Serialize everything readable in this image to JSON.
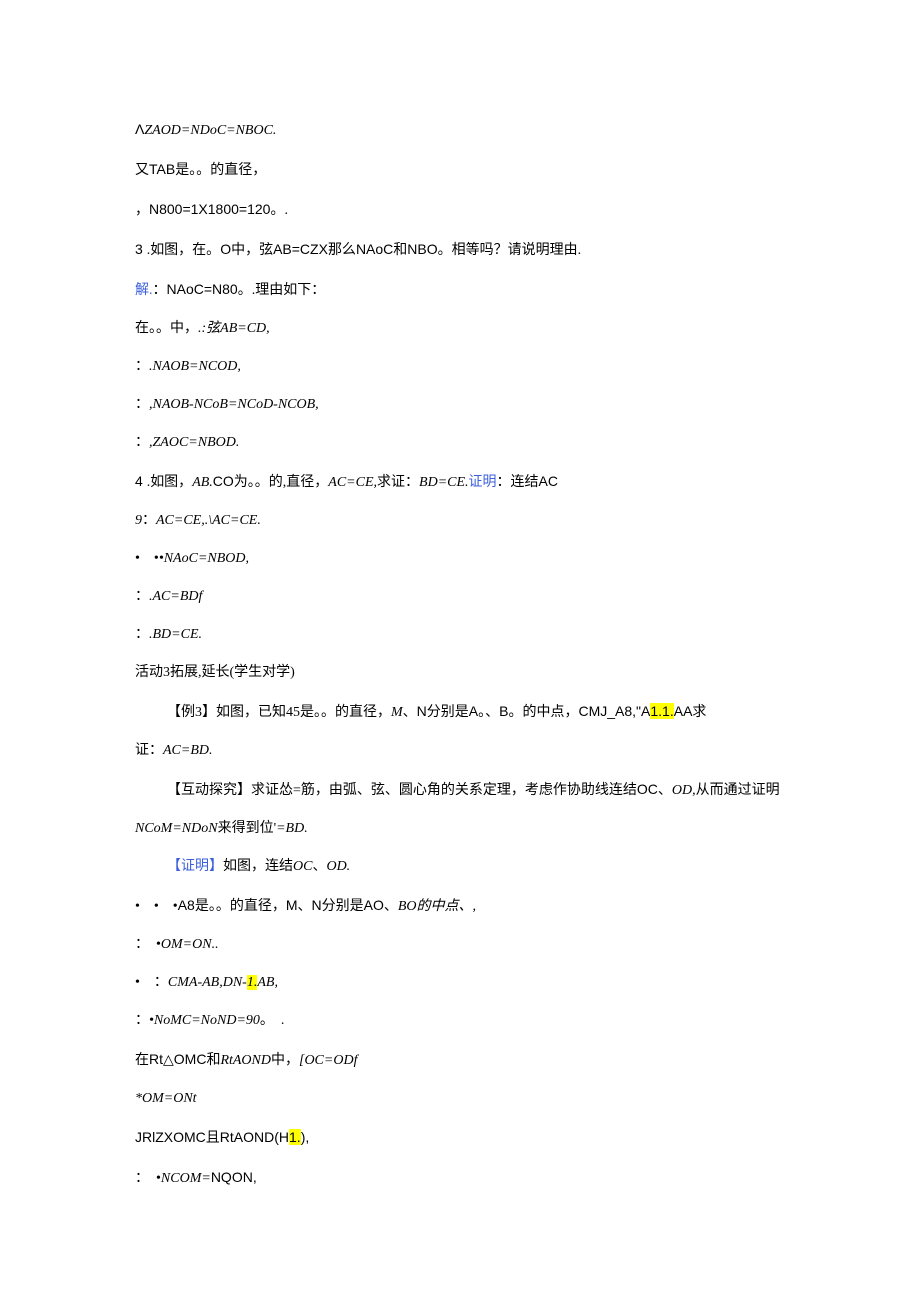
{
  "lines": [
    {
      "cls": "line",
      "segs": [
        {
          "cls": "sans",
          "txt": "Λ"
        },
        {
          "cls": "italic",
          "txt": "ZAOD=NDoC=NBOC."
        }
      ]
    },
    {
      "cls": "line",
      "segs": [
        {
          "cls": "",
          "txt": "又"
        },
        {
          "cls": "sans",
          "txt": "TAB"
        },
        {
          "cls": "",
          "txt": "是。。的直径，"
        }
      ]
    },
    {
      "cls": "line",
      "segs": [
        {
          "cls": "",
          "txt": "，"
        },
        {
          "cls": "sans",
          "txt": "N800=1X1800=120"
        },
        {
          "cls": "",
          "txt": "。."
        }
      ]
    },
    {
      "cls": "line",
      "segs": [
        {
          "cls": "sans",
          "txt": "3 "
        },
        {
          "cls": "",
          "txt": ".如图，在。"
        },
        {
          "cls": "sans",
          "txt": "O"
        },
        {
          "cls": "",
          "txt": "中，弦"
        },
        {
          "cls": "sans",
          "txt": "AB=CZX"
        },
        {
          "cls": "",
          "txt": "那么"
        },
        {
          "cls": "sans",
          "txt": "NAoC"
        },
        {
          "cls": "",
          "txt": "和"
        },
        {
          "cls": "sans",
          "txt": "NBO"
        },
        {
          "cls": "",
          "txt": "。相等吗？请说明理由."
        }
      ]
    },
    {
      "cls": "line",
      "segs": [
        {
          "cls": "blue",
          "txt": "解."
        },
        {
          "cls": "",
          "txt": "："
        },
        {
          "cls": "sans",
          "txt": "NAoC=N80"
        },
        {
          "cls": "",
          "txt": "。.理由如下："
        }
      ]
    },
    {
      "cls": "line",
      "segs": [
        {
          "cls": "",
          "txt": "在。。中，"
        },
        {
          "cls": "italic",
          "txt": ".:弦AB=CD,"
        }
      ]
    },
    {
      "cls": "line",
      "segs": [
        {
          "cls": "",
          "txt": "："
        },
        {
          "cls": "italic",
          "txt": ".NAOB=NCOD,"
        }
      ]
    },
    {
      "cls": "line",
      "segs": [
        {
          "cls": "",
          "txt": "："
        },
        {
          "cls": "italic",
          "txt": ",NAOB-NCoB=NCoD-NCOB,"
        }
      ]
    },
    {
      "cls": "line",
      "segs": [
        {
          "cls": "",
          "txt": "："
        },
        {
          "cls": "italic",
          "txt": ",ZAOC=NBOD."
        }
      ]
    },
    {
      "cls": "line",
      "segs": [
        {
          "cls": "sans",
          "txt": "4 "
        },
        {
          "cls": "",
          "txt": ".如图，"
        },
        {
          "cls": "italic",
          "txt": "AB."
        },
        {
          "cls": "sans",
          "txt": "CO"
        },
        {
          "cls": "",
          "txt": "为。。的,直径，"
        },
        {
          "cls": "italic",
          "txt": "AC=CE,"
        },
        {
          "cls": "",
          "txt": "求证："
        },
        {
          "cls": "italic",
          "txt": "BD=CE."
        },
        {
          "cls": "blue",
          "txt": "证明"
        },
        {
          "cls": "",
          "txt": "：连结"
        },
        {
          "cls": "sans",
          "txt": "AC"
        }
      ]
    },
    {
      "cls": "line",
      "segs": [
        {
          "cls": "italic",
          "txt": " 9"
        },
        {
          "cls": "",
          "txt": "："
        },
        {
          "cls": "italic",
          "txt": "AC=CE,.\\AC=CE."
        }
      ]
    },
    {
      "cls": "line",
      "segs": [
        {
          "cls": "",
          "txt": "•　•"
        },
        {
          "cls": "italic",
          "txt": "•NAoC=NBOD,"
        }
      ]
    },
    {
      "cls": "line",
      "segs": [
        {
          "cls": "",
          "txt": "："
        },
        {
          "cls": "italic",
          "txt": ".AC=BDf"
        }
      ]
    },
    {
      "cls": "line",
      "segs": [
        {
          "cls": "",
          "txt": "："
        },
        {
          "cls": "italic",
          "txt": ".BD=CE."
        }
      ]
    },
    {
      "cls": "line",
      "segs": [
        {
          "cls": "",
          "txt": "活动3拓展,延长(学生对学)"
        }
      ]
    },
    {
      "cls": "line indent1",
      "segs": [
        {
          "cls": "",
          "txt": "【例3】如图，已知45是。。的直径，"
        },
        {
          "cls": "italic",
          "txt": "M"
        },
        {
          "cls": "",
          "txt": "、"
        },
        {
          "cls": "sans",
          "txt": "N"
        },
        {
          "cls": "",
          "txt": "分别是"
        },
        {
          "cls": "sans",
          "txt": "A"
        },
        {
          "cls": "",
          "txt": "。、"
        },
        {
          "cls": "sans",
          "txt": "B"
        },
        {
          "cls": "",
          "txt": "。的中点，"
        },
        {
          "cls": "sans",
          "txt": "CMJ_A8,\"A"
        },
        {
          "cls": "hl sans",
          "txt": "1.1."
        },
        {
          "cls": "sans",
          "txt": "AA"
        },
        {
          "cls": "",
          "txt": "求"
        }
      ]
    },
    {
      "cls": "line indent-neg",
      "segs": [
        {
          "cls": "",
          "txt": "证："
        },
        {
          "cls": "italic",
          "txt": "AC=BD."
        }
      ]
    },
    {
      "cls": "line indent1",
      "segs": [
        {
          "cls": "",
          "txt": "【互动探究】求证怂=筋，由弧、弦、圆心角的关系定理，考虑作协助线连结"
        },
        {
          "cls": "sans",
          "txt": "OC"
        },
        {
          "cls": "",
          "txt": "、"
        },
        {
          "cls": "italic",
          "txt": "OD,"
        },
        {
          "cls": "",
          "txt": "从而通过证明"
        }
      ]
    },
    {
      "cls": "line indent-neg",
      "segs": [
        {
          "cls": "italic",
          "txt": "NCoM=NDoN"
        },
        {
          "cls": "",
          "txt": "来得到位'"
        },
        {
          "cls": "italic",
          "txt": "=BD."
        }
      ]
    },
    {
      "cls": "line indent1",
      "segs": [
        {
          "cls": "blue",
          "txt": "【证明】"
        },
        {
          "cls": "",
          "txt": "如图，连结"
        },
        {
          "cls": "italic",
          "txt": "OC"
        },
        {
          "cls": "",
          "txt": "、"
        },
        {
          "cls": "italic",
          "txt": "OD."
        }
      ]
    },
    {
      "cls": "line",
      "segs": [
        {
          "cls": "",
          "txt": "•　•　•"
        },
        {
          "cls": "sans",
          "txt": "A8"
        },
        {
          "cls": "",
          "txt": "是。。的直径，"
        },
        {
          "cls": "sans",
          "txt": "M"
        },
        {
          "cls": "",
          "txt": "、"
        },
        {
          "cls": "sans",
          "txt": "N"
        },
        {
          "cls": "",
          "txt": "分别是"
        },
        {
          "cls": "sans",
          "txt": "AO"
        },
        {
          "cls": "",
          "txt": "、"
        },
        {
          "cls": "italic",
          "txt": "BO的中点、,"
        }
      ]
    },
    {
      "cls": "line",
      "segs": [
        {
          "cls": "",
          "txt": "：　•"
        },
        {
          "cls": "italic",
          "txt": "OM=ON.."
        }
      ]
    },
    {
      "cls": "line",
      "segs": [
        {
          "cls": "",
          "txt": "•　："
        },
        {
          "cls": "italic",
          "txt": "CMA-AB,DN-"
        },
        {
          "cls": "hl italic",
          "txt": "1."
        },
        {
          "cls": "italic",
          "txt": "AB,"
        }
      ]
    },
    {
      "cls": "line",
      "segs": [
        {
          "cls": "",
          "txt": "："
        },
        {
          "cls": "italic",
          "txt": "•NoMC=NoND=90"
        },
        {
          "cls": "",
          "txt": "。　."
        }
      ]
    },
    {
      "cls": "line",
      "segs": [
        {
          "cls": "",
          "txt": " 在"
        },
        {
          "cls": "sans",
          "txt": "Rt△OMC"
        },
        {
          "cls": "",
          "txt": "和"
        },
        {
          "cls": "italic",
          "txt": "RtAOND"
        },
        {
          "cls": "",
          "txt": "中，"
        },
        {
          "cls": "italic",
          "txt": "[OC=ODf"
        }
      ]
    },
    {
      "cls": "line",
      "segs": [
        {
          "cls": "italic",
          "txt": "  *OM=ONt"
        }
      ]
    },
    {
      "cls": "line",
      "segs": [
        {
          "cls": "sans",
          "txt": " JRlZXOMC"
        },
        {
          "cls": "",
          "txt": "且"
        },
        {
          "cls": "sans",
          "txt": "RtAOND(H"
        },
        {
          "cls": "hl sans",
          "txt": "1."
        },
        {
          "cls": "sans",
          "txt": "),"
        }
      ]
    },
    {
      "cls": "line",
      "segs": [
        {
          "cls": "",
          "txt": "：　•"
        },
        {
          "cls": "italic",
          "txt": "NCOM="
        },
        {
          "cls": "sans",
          "txt": "NQON,"
        }
      ]
    }
  ]
}
